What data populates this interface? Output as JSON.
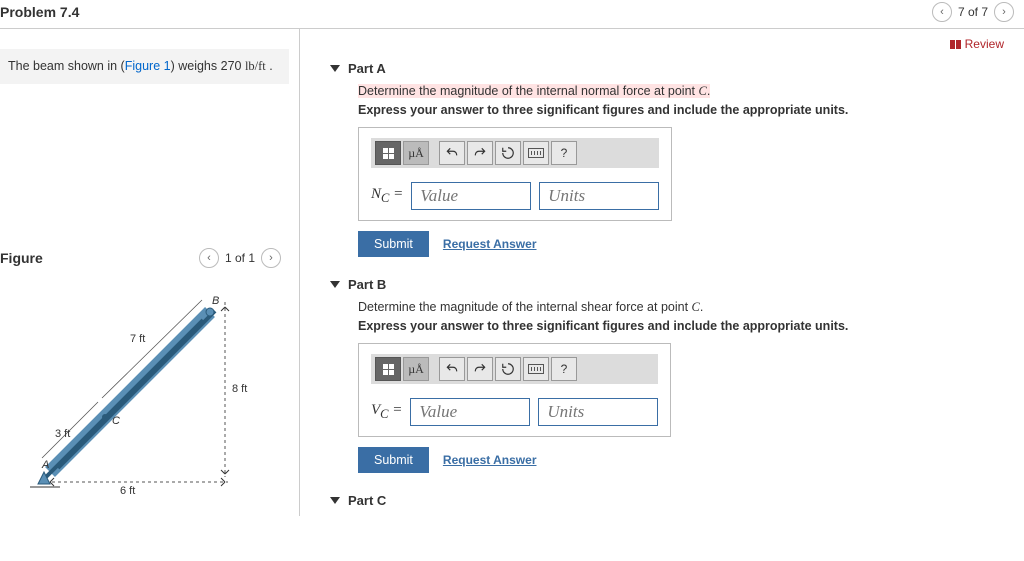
{
  "header": {
    "title": "Problem 7.4",
    "nav_text": "7 of 7"
  },
  "review": {
    "label": "Review"
  },
  "problem_text": {
    "prefix": "The beam shown in (",
    "figure_link": "Figure 1",
    "mid": ") weighs 270 ",
    "unit": "lb/ft",
    "suffix": " ."
  },
  "figure": {
    "title": "Figure",
    "nav_text": "1 of 1",
    "labels": {
      "A": "A",
      "B": "B",
      "C": "C",
      "d1": "7 ft",
      "d2": "3 ft",
      "d3": "6 ft",
      "d4": "8 ft"
    }
  },
  "parts": {
    "A": {
      "title": "Part A",
      "prompt_prefix": "Determine the magnitude of the internal normal force at point ",
      "prompt_var": "C",
      "prompt_suffix": ".",
      "instruction": "Express your answer to three significant figures and include the appropriate units.",
      "var_label": "N",
      "var_sub": "C",
      "equals": " = ",
      "value_placeholder": "Value",
      "units_placeholder": "Units",
      "submit": "Submit",
      "request": "Request Answer",
      "highlighted": true
    },
    "B": {
      "title": "Part B",
      "prompt_prefix": "Determine the magnitude of the internal shear force at point ",
      "prompt_var": "C",
      "prompt_suffix": ".",
      "instruction": "Express your answer to three significant figures and include the appropriate units.",
      "var_label": "V",
      "var_sub": "C",
      "equals": " = ",
      "value_placeholder": "Value",
      "units_placeholder": "Units",
      "submit": "Submit",
      "request": "Request Answer",
      "highlighted": false
    },
    "C": {
      "title": "Part C"
    }
  },
  "toolbar": {
    "mu": "µÅ",
    "help": "?"
  }
}
